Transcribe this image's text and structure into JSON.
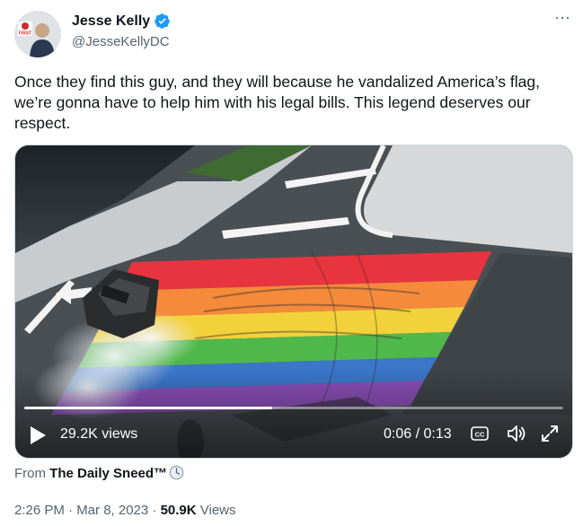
{
  "author": {
    "display_name": "Jesse Kelly",
    "handle": "@JesseKellyDC",
    "verified": true,
    "avatar_badge": "FIRST"
  },
  "tweet": {
    "text": "Once they find this guy, and they will because he vandalized America’s flag, we’re gonna have to help him with his legal bills. This legend deserves our respect."
  },
  "video": {
    "views": "29.2K views",
    "time": "0:06 / 0:13",
    "progress": 0.46,
    "cc_label": "CC"
  },
  "source": {
    "prefix": "From",
    "name": "The Daily Sneed™"
  },
  "meta": {
    "timestamp": "2:26 PM · Mar 8, 2023 · ",
    "view_count": "50.9K",
    "views_label": " Views"
  },
  "colors": {
    "verified": "#1d9bf0",
    "text_secondary": "#536471",
    "rainbow": [
      "#e8343f",
      "#f58a3a",
      "#f2d13a",
      "#4fb84a",
      "#3b76c8",
      "#8a4fb8"
    ]
  },
  "icons": {
    "more": "more-dots-icon",
    "play": "play-icon",
    "captions": "captions-icon",
    "volume": "volume-icon",
    "fullscreen": "fullscreen-icon",
    "clock": "clock-icon"
  }
}
